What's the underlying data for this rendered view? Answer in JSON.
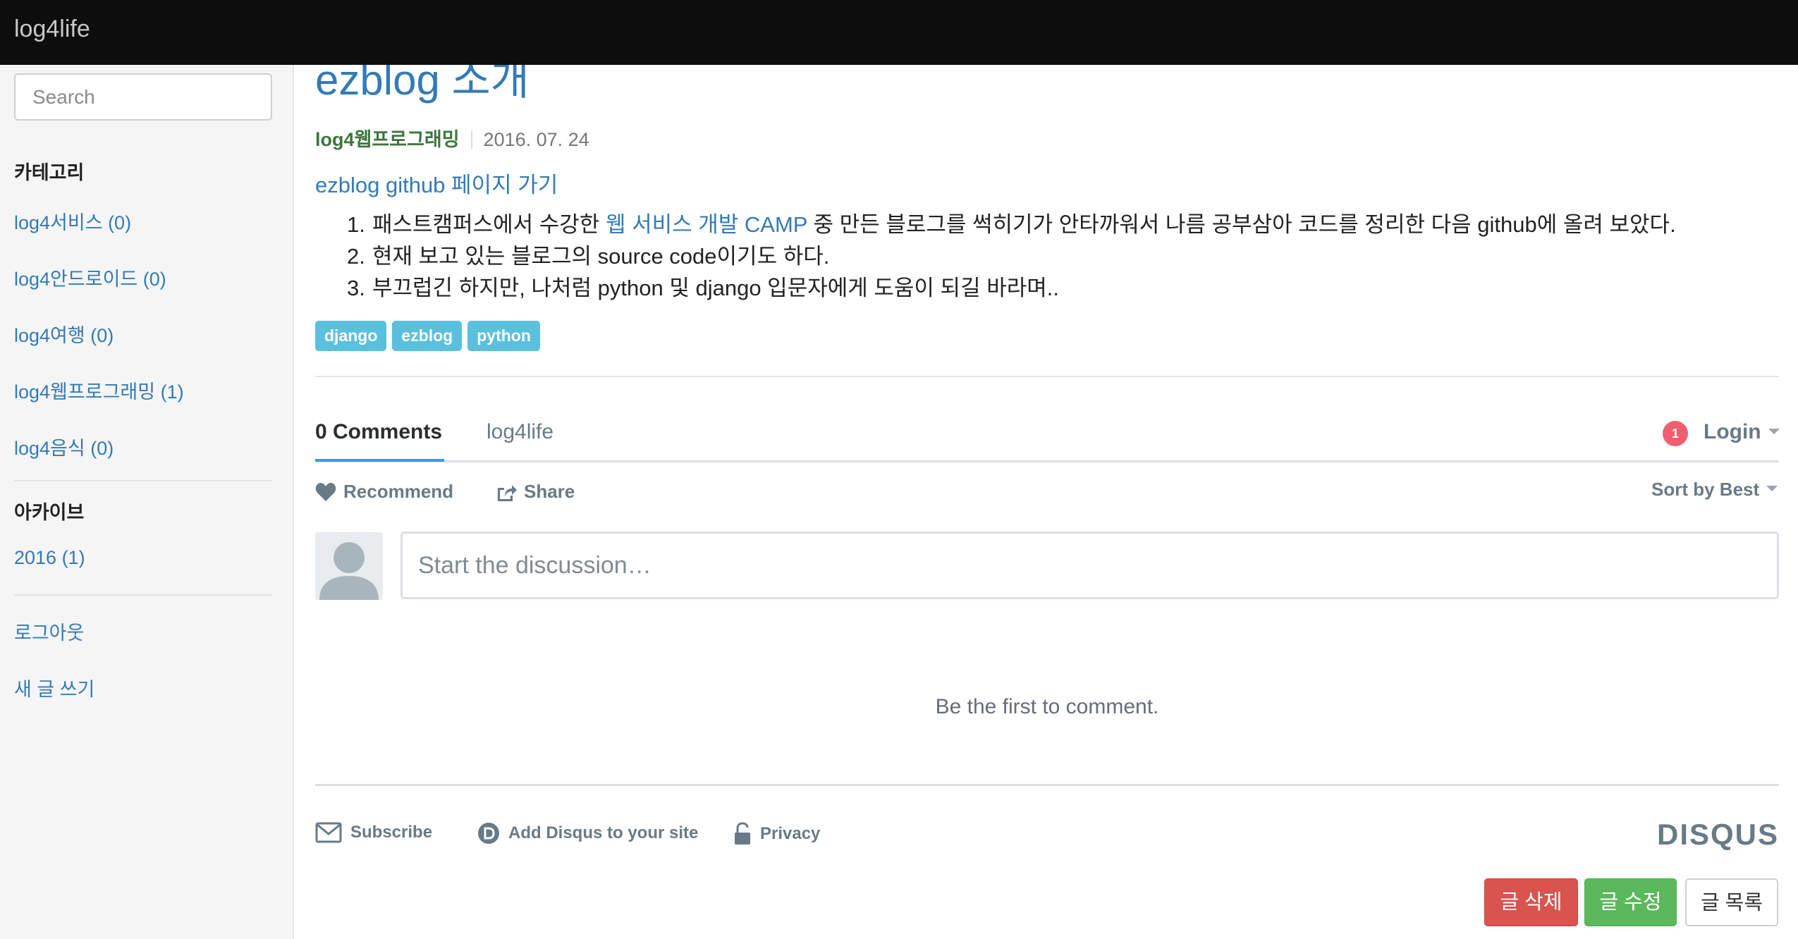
{
  "navbar": {
    "brand": "log4life"
  },
  "sidebar": {
    "search_placeholder": "Search",
    "category_heading": "카테고리",
    "categories": [
      {
        "label": "log4서비스 (0)"
      },
      {
        "label": "log4안드로이드 (0)"
      },
      {
        "label": "log4여행 (0)"
      },
      {
        "label": "log4웹프로그래밍 (1)"
      },
      {
        "label": "log4음식 (0)"
      }
    ],
    "archive_heading": "아카이브",
    "archives": [
      {
        "label": "2016 (1)"
      }
    ],
    "logout": "로그아웃",
    "new_post": "새 글 쓰기"
  },
  "post": {
    "title": "ezblog 소개",
    "category": "log4웹프로그래밍",
    "date": "2016. 07. 24",
    "github_link": "ezblog github 페이지 가기",
    "items": [
      {
        "num": "1.",
        "before": "패스트캠퍼스에서 수강한 ",
        "link": "웹 서비스 개발 CAMP",
        "after": " 중 만든 블로그를 썩히기가 안타까워서 나름 공부삼아 코드를 정리한 다음 github에 올려 보았다."
      },
      {
        "num": "2.",
        "before": "현재 보고 있는 블로그의 source code이기도 하다.",
        "link": "",
        "after": ""
      },
      {
        "num": "3.",
        "before": "부끄럽긴 하지만, 나처럼 python 및 django 입문자에게 도움이 되길 바라며..",
        "link": "",
        "after": ""
      }
    ],
    "tags": [
      "django",
      "ezblog",
      "python"
    ]
  },
  "disqus": {
    "comments_tab": "0 Comments",
    "site_tab": "log4life",
    "notification_count": "1",
    "login": "Login",
    "recommend": "Recommend",
    "share": "Share",
    "sort": "Sort by Best",
    "input_placeholder": "Start the discussion…",
    "empty_message": "Be the first to comment.",
    "subscribe": "Subscribe",
    "add_disqus": "Add Disqus to your site",
    "privacy": "Privacy",
    "logo": "DISQUS"
  },
  "actions": {
    "delete": "글 삭제",
    "edit": "글 수정",
    "list": "글 목록"
  },
  "colors": {
    "link": "#337ab7",
    "category_green": "#3c763d",
    "tag_bg": "#5bc0de",
    "danger": "#d9534f",
    "success": "#5cb85c",
    "disqus_accent": "#2e9fff"
  }
}
